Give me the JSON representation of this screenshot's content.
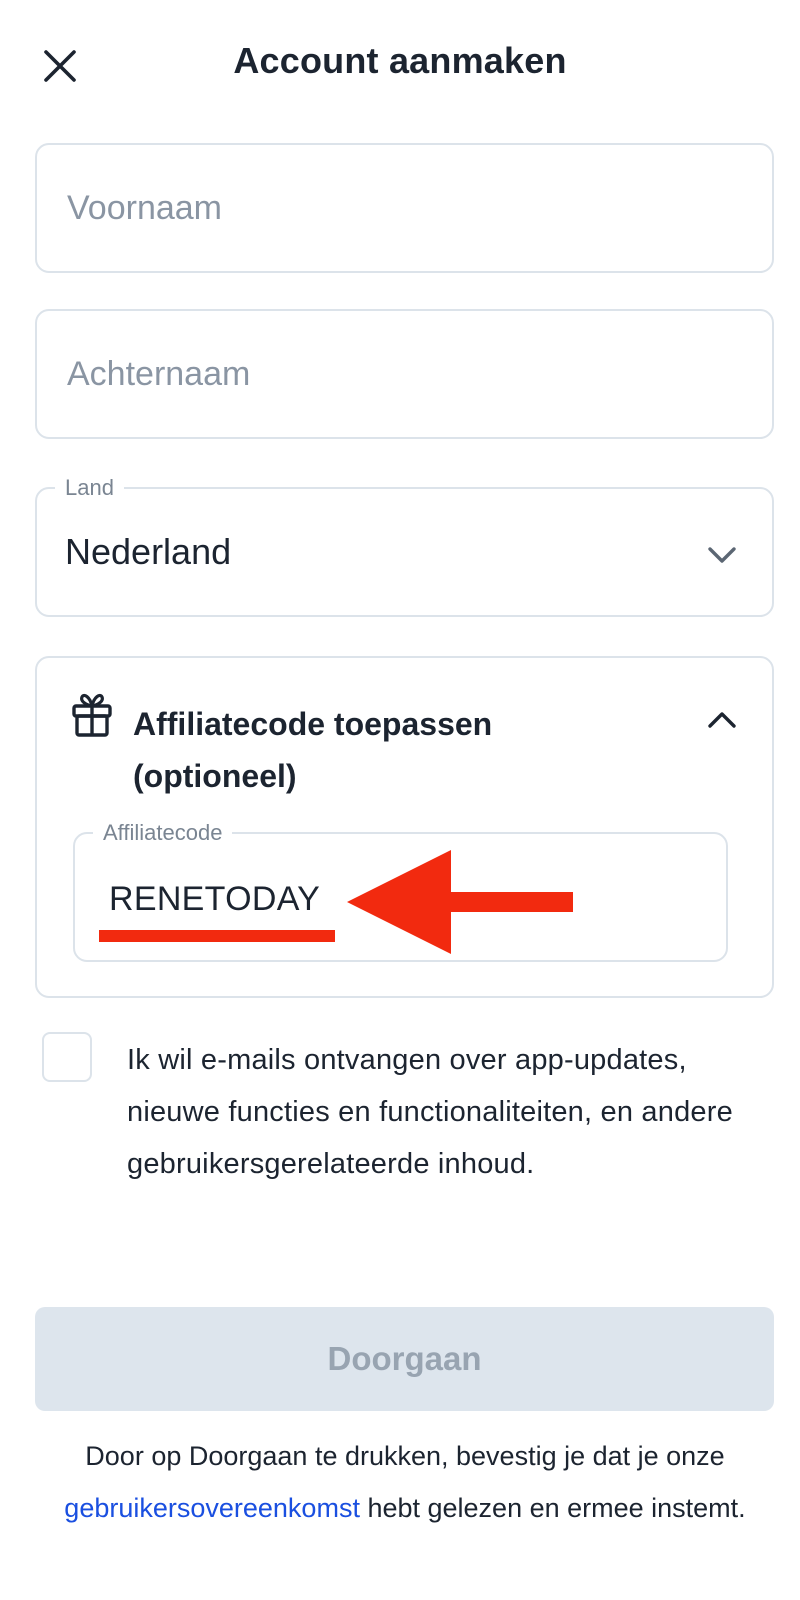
{
  "header": {
    "title": "Account aanmaken",
    "close_icon": "close-icon"
  },
  "form": {
    "first_name": {
      "value": "",
      "placeholder": "Voornaam"
    },
    "last_name": {
      "value": "",
      "placeholder": "Achternaam"
    },
    "country": {
      "label": "Land",
      "value": "Nederland",
      "icon": "chevron-down-icon"
    }
  },
  "affiliate": {
    "icon": "gift-icon",
    "title": "Affiliatecode toepassen (optioneel)",
    "expanded_icon": "chevron-up-icon",
    "input_label": "Affiliatecode",
    "input_value": "RENETODAY"
  },
  "annotation": {
    "color": "#f22a0f"
  },
  "consent": {
    "checked": false,
    "text": "Ik wil e-mails ontvangen over app-updates, nieuwe functies en functionaliteiten, en andere gebruikersgerelateerde inhoud."
  },
  "continue_button": {
    "label": "Doorgaan",
    "disabled": true
  },
  "terms": {
    "prefix": "Door op Doorgaan te drukken, bevestig je dat je onze ",
    "link": "gebruikersovereenkomst",
    "suffix": " hebt gelezen en ermee instemt."
  }
}
